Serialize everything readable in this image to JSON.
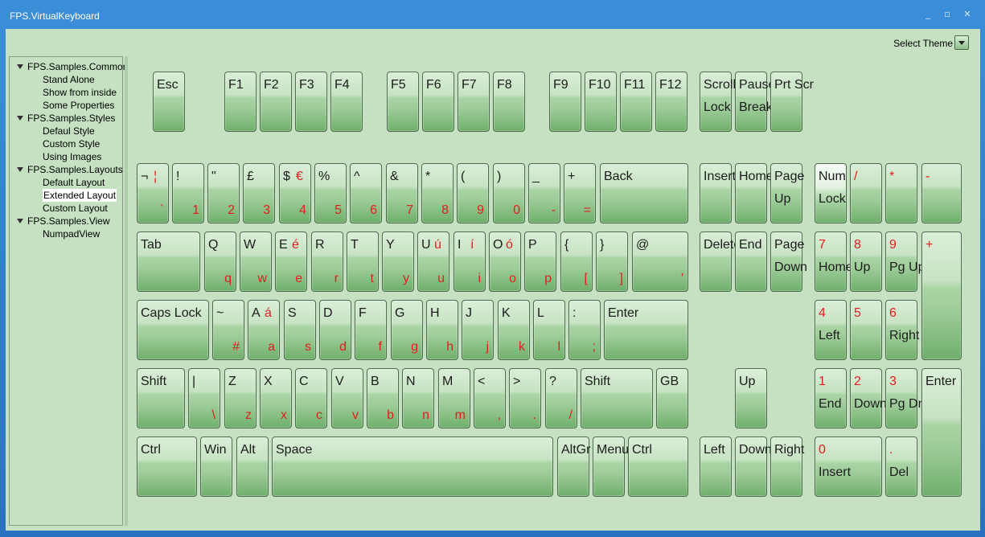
{
  "window": {
    "title": "FPS.VirtualKeyboard",
    "minimize": "_",
    "maximize": "▫",
    "close": "✕"
  },
  "theme": {
    "label": "Select Theme"
  },
  "tree": [
    {
      "label": "FPS.Samples.Common",
      "children": [
        "Stand Alone",
        "Show from inside",
        "Some Properties"
      ]
    },
    {
      "label": "FPS.Samples.Styles",
      "children": [
        "Defaul Style",
        "Custom Style",
        "Using Images"
      ]
    },
    {
      "label": "FPS.Samples.Layouts",
      "children": [
        "Default Layout",
        "Extended Layout",
        "Custom Layout"
      ]
    },
    {
      "label": "FPS.Samples.View",
      "children": [
        "NumpadView"
      ]
    }
  ],
  "selected": "Extended Layout",
  "keys": [
    {
      "id": "esc",
      "tl": "Esc"
    },
    {
      "id": "f1",
      "tl": "F1"
    },
    {
      "id": "f2",
      "tl": "F2"
    },
    {
      "id": "f3",
      "tl": "F3"
    },
    {
      "id": "f4",
      "tl": "F4"
    },
    {
      "id": "f5",
      "tl": "F5"
    },
    {
      "id": "f6",
      "tl": "F6"
    },
    {
      "id": "f7",
      "tl": "F7"
    },
    {
      "id": "f8",
      "tl": "F8"
    },
    {
      "id": "f9",
      "tl": "F9"
    },
    {
      "id": "f10",
      "tl": "F10"
    },
    {
      "id": "f11",
      "tl": "F11"
    },
    {
      "id": "f12",
      "tl": "F12"
    },
    {
      "id": "scroll-lock",
      "tl": "Scroll",
      "bl": "Lock"
    },
    {
      "id": "pause-break",
      "tl": "Pause",
      "bl": "Break"
    },
    {
      "id": "prt-scr",
      "tl": "Prt Scr"
    },
    {
      "id": "not",
      "tl": "¬",
      "tr": "¦",
      "br": "`"
    },
    {
      "id": "d1",
      "tl": "!",
      "br": "1"
    },
    {
      "id": "d2",
      "tl": "\"",
      "br": "2"
    },
    {
      "id": "d3",
      "tl": "£",
      "br": "3"
    },
    {
      "id": "d4",
      "tl": "$",
      "tr": "€",
      "br": "4"
    },
    {
      "id": "d5",
      "tl": "%",
      "br": "5"
    },
    {
      "id": "d6",
      "tl": "^",
      "br": "6"
    },
    {
      "id": "d7",
      "tl": "&",
      "br": "7"
    },
    {
      "id": "d8",
      "tl": "*",
      "br": "8"
    },
    {
      "id": "d9",
      "tl": "(",
      "br": "9"
    },
    {
      "id": "d0",
      "tl": ")",
      "br": "0"
    },
    {
      "id": "minus",
      "tl": "_",
      "br": "-"
    },
    {
      "id": "equals",
      "tl": "+",
      "br": "="
    },
    {
      "id": "back",
      "tl": "Back"
    },
    {
      "id": "insert",
      "tl": "Insert"
    },
    {
      "id": "home",
      "tl": "Home"
    },
    {
      "id": "page-up",
      "tl": "Page",
      "bl": "Up"
    },
    {
      "id": "num-lock",
      "tl": "Num",
      "bl": "Lock"
    },
    {
      "id": "np-div",
      "tlr": "/"
    },
    {
      "id": "np-mul",
      "tlr": "*"
    },
    {
      "id": "np-sub",
      "tlr": "-"
    },
    {
      "id": "tab",
      "tl": "Tab"
    },
    {
      "id": "q",
      "tl": "Q",
      "br": "q"
    },
    {
      "id": "w",
      "tl": "W",
      "br": "w"
    },
    {
      "id": "e",
      "tl": "E",
      "tr": "é",
      "br": "e"
    },
    {
      "id": "r",
      "tl": "R",
      "br": "r"
    },
    {
      "id": "t",
      "tl": "T",
      "br": "t"
    },
    {
      "id": "y",
      "tl": "Y",
      "br": "y"
    },
    {
      "id": "u",
      "tl": "U",
      "tr": "ú",
      "br": "u"
    },
    {
      "id": "i",
      "tl": "I",
      "tr": "í",
      "br": "i"
    },
    {
      "id": "o",
      "tl": "O",
      "tr": "ó",
      "br": "o"
    },
    {
      "id": "p",
      "tl": "P",
      "br": "p"
    },
    {
      "id": "lbrace",
      "tl": "{",
      "br": "["
    },
    {
      "id": "rbrace",
      "tl": "}",
      "br": "]"
    },
    {
      "id": "at",
      "tl": "@",
      "br": "'"
    },
    {
      "id": "delete",
      "tl": "Delete"
    },
    {
      "id": "end",
      "tl": "End"
    },
    {
      "id": "page-down",
      "tl": "Page",
      "bl": "Down"
    },
    {
      "id": "np7",
      "tlr": "7",
      "bl": "Home"
    },
    {
      "id": "np8",
      "tlr": "8",
      "bl": "Up"
    },
    {
      "id": "np9",
      "tlr": "9",
      "bl": "Pg Up"
    },
    {
      "id": "np-add",
      "tlr": "+"
    },
    {
      "id": "caps-lock",
      "tl": "Caps Lock"
    },
    {
      "id": "tilde",
      "tl": "~",
      "br": "#"
    },
    {
      "id": "a",
      "tl": "A",
      "tr": "á",
      "br": "a"
    },
    {
      "id": "s",
      "tl": "S",
      "br": "s"
    },
    {
      "id": "d",
      "tl": "D",
      "br": "d"
    },
    {
      "id": "f",
      "tl": "F",
      "br": "f"
    },
    {
      "id": "g",
      "tl": "G",
      "br": "g"
    },
    {
      "id": "h",
      "tl": "H",
      "br": "h"
    },
    {
      "id": "j",
      "tl": "J",
      "br": "j"
    },
    {
      "id": "k",
      "tl": "K",
      "br": "k"
    },
    {
      "id": "l",
      "tl": "L",
      "br": "l"
    },
    {
      "id": "colon",
      "tl": ":",
      "br": ";"
    },
    {
      "id": "enter",
      "tl": "Enter"
    },
    {
      "id": "np4",
      "tlr": "4",
      "bl": "Left"
    },
    {
      "id": "np5",
      "tlr": "5"
    },
    {
      "id": "np6",
      "tlr": "6",
      "bl": "Right"
    },
    {
      "id": "lshift",
      "tl": "Shift"
    },
    {
      "id": "pipe",
      "tl": "|",
      "br": "\\"
    },
    {
      "id": "z",
      "tl": "Z",
      "br": "z"
    },
    {
      "id": "x",
      "tl": "X",
      "br": "x"
    },
    {
      "id": "c",
      "tl": "C",
      "br": "c"
    },
    {
      "id": "v",
      "tl": "V",
      "br": "v"
    },
    {
      "id": "b",
      "tl": "B",
      "br": "b"
    },
    {
      "id": "n",
      "tl": "N",
      "br": "n"
    },
    {
      "id": "m",
      "tl": "M",
      "br": "m"
    },
    {
      "id": "lt",
      "tl": "<",
      "br": ","
    },
    {
      "id": "gt",
      "tl": ">",
      "br": "."
    },
    {
      "id": "question",
      "tl": "?",
      "br": "/"
    },
    {
      "id": "rshift",
      "tl": "Shift"
    },
    {
      "id": "gb",
      "tl": "GB"
    },
    {
      "id": "arrow-up",
      "tl": "Up"
    },
    {
      "id": "np1",
      "tlr": "1",
      "bl": "End"
    },
    {
      "id": "np2",
      "tlr": "2",
      "bl": "Down"
    },
    {
      "id": "np3",
      "tlr": "3",
      "bl": "Pg Dn"
    },
    {
      "id": "np-enter",
      "tl": "Enter"
    },
    {
      "id": "lctrl",
      "tl": "Ctrl"
    },
    {
      "id": "win",
      "tl": "Win"
    },
    {
      "id": "alt",
      "tl": "Alt"
    },
    {
      "id": "space",
      "tl": "Space"
    },
    {
      "id": "altgr",
      "tl": "AltGr"
    },
    {
      "id": "menu",
      "tl": "Menu"
    },
    {
      "id": "rctrl",
      "tl": "Ctrl"
    },
    {
      "id": "arrow-left",
      "tl": "Left"
    },
    {
      "id": "arrow-down",
      "tl": "Down"
    },
    {
      "id": "arrow-right",
      "tl": "Right"
    },
    {
      "id": "np0",
      "tlr": "0",
      "bl": "Insert"
    },
    {
      "id": "np-dec",
      "tlr": ".",
      "bl": "Del"
    }
  ]
}
